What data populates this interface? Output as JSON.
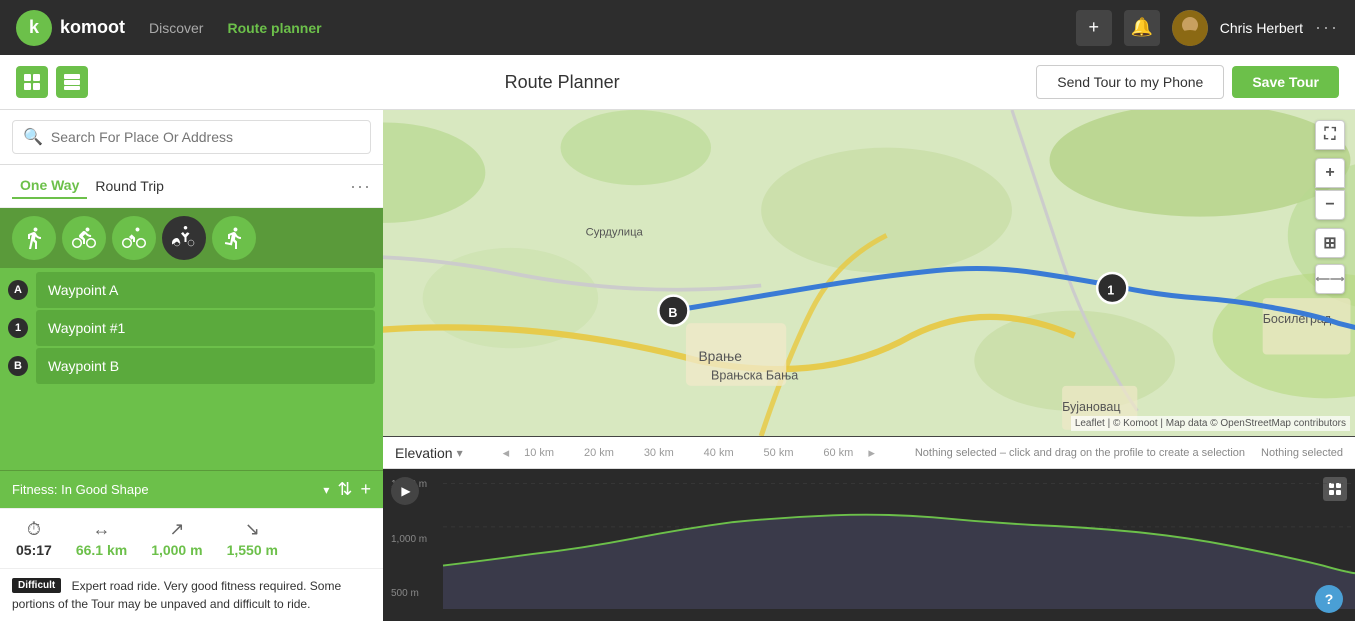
{
  "nav": {
    "logo_text": "komoot",
    "discover_label": "Discover",
    "route_planner_label": "Route planner",
    "user_name": "Chris Herbert"
  },
  "header": {
    "title": "Route Planner",
    "send_tour_label": "Send Tour to my Phone",
    "save_tour_label": "Save Tour"
  },
  "search": {
    "placeholder": "Search For Place Or Address"
  },
  "trip": {
    "one_way_label": "One Way",
    "round_trip_label": "Round Trip"
  },
  "waypoints": [
    {
      "id": "A",
      "label": "Waypoint A"
    },
    {
      "id": "1",
      "label": "Waypoint #1"
    },
    {
      "id": "B",
      "label": "Waypoint B"
    }
  ],
  "fitness": {
    "label": "Fitness: In Good Shape"
  },
  "stats": {
    "time": "05:17",
    "distance": "66.1",
    "distance_unit": "km",
    "ascent": "1,000",
    "ascent_unit": "m",
    "descent": "1,550",
    "descent_unit": "m"
  },
  "difficulty": {
    "badge": "Difficult",
    "description": "Expert road ride. Very good fitness required. Some portions of the Tour may be unpaved and difficult to ride."
  },
  "elevation": {
    "label": "Elevation",
    "notice": "Nothing selected – click and drag on the profile to create a selection",
    "nothing_selected": "Nothing selected",
    "km_markers": [
      "10 km",
      "20 km",
      "30 km",
      "40 km",
      "50 km",
      "60 km"
    ],
    "y_labels": [
      "1,500 m",
      "1,000 m",
      "500 m"
    ]
  },
  "icons": {
    "search": "🔍",
    "play": "▶",
    "help": "?",
    "plus": "+",
    "minus": "−",
    "layers": "⊞",
    "fullscreen": "⛶",
    "chevron_down": "▾",
    "arrow_left": "◂",
    "arrow_right": "▸"
  }
}
